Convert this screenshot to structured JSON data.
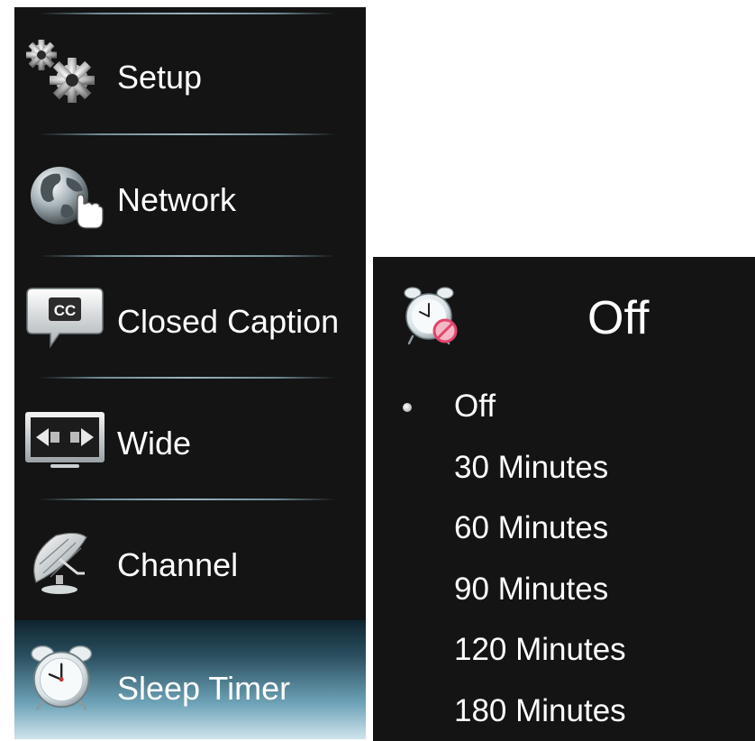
{
  "menu": {
    "items": [
      {
        "label": "Setup",
        "icon": "gears-icon"
      },
      {
        "label": "Network",
        "icon": "globe-network-icon"
      },
      {
        "label": "Closed Caption",
        "icon": "closed-caption-icon"
      },
      {
        "label": "Wide",
        "icon": "wide-screen-icon"
      },
      {
        "label": "Channel",
        "icon": "satellite-dish-icon"
      },
      {
        "label": "Sleep Timer",
        "icon": "alarm-clock-icon",
        "selected": true
      }
    ]
  },
  "panel": {
    "icon": "alarm-clock-off-icon",
    "current_value": "Off",
    "options": [
      "Off",
      "30 Minutes",
      "60 Minutes",
      "90 Minutes",
      "120 Minutes",
      "180 Minutes"
    ],
    "selected_option": "Off",
    "cc_badge": "CC"
  },
  "colors": {
    "background": "#141414",
    "text": "#ffffff",
    "selected_gradient_top": "#0f2530",
    "selected_gradient_bottom": "#cfe4ec",
    "separator": "#9bb4bd",
    "no_symbol": "#e2456b"
  }
}
